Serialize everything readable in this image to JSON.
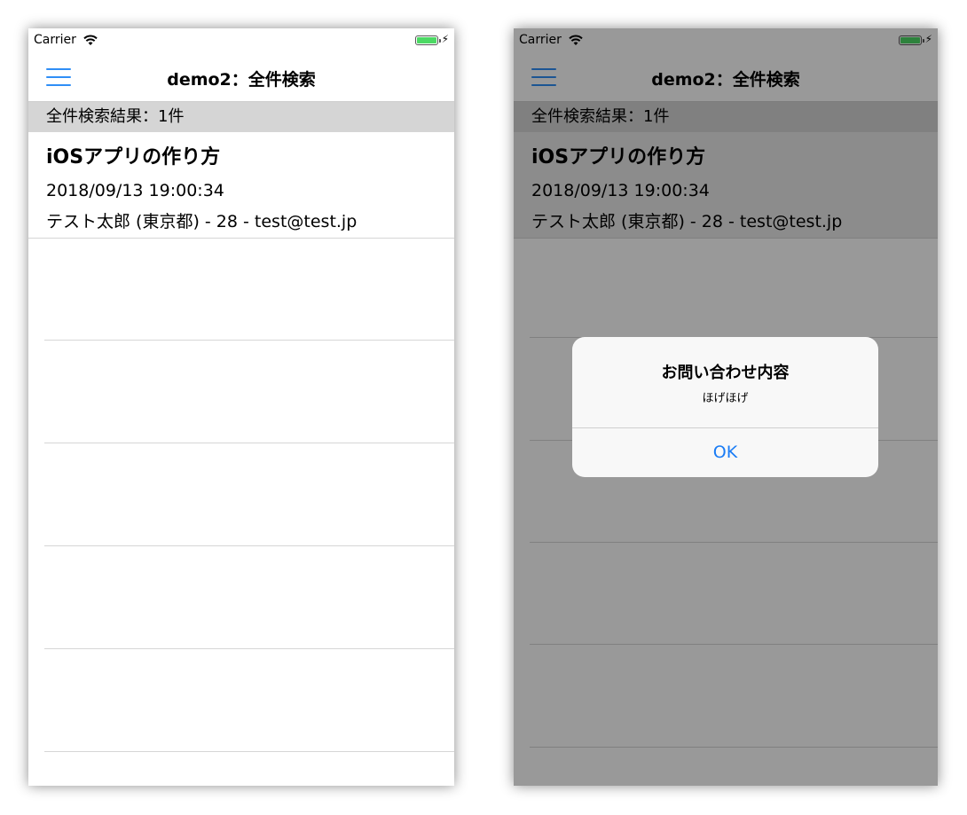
{
  "status_bar": {
    "carrier": "Carrier",
    "charging_icon": "bolt-icon"
  },
  "nav": {
    "title": "demo2：全件検索",
    "menu_icon": "hamburger-menu-icon"
  },
  "results": {
    "header": "全件検索結果：1件"
  },
  "items": [
    {
      "title": "iOSアプリの作り方",
      "datetime": "2018/09/13 19:00:34",
      "person": "テスト太郎 (東京都) - 28 - test@test.jp"
    }
  ],
  "alert": {
    "title": "お問い合わせ内容",
    "message": "ほげほげ",
    "ok_label": "OK"
  },
  "colors": {
    "accent": "#2f8ef6",
    "battery": "#4cd964",
    "header_bg": "#d5d5d5",
    "alert_button": "#1a7cf5"
  }
}
